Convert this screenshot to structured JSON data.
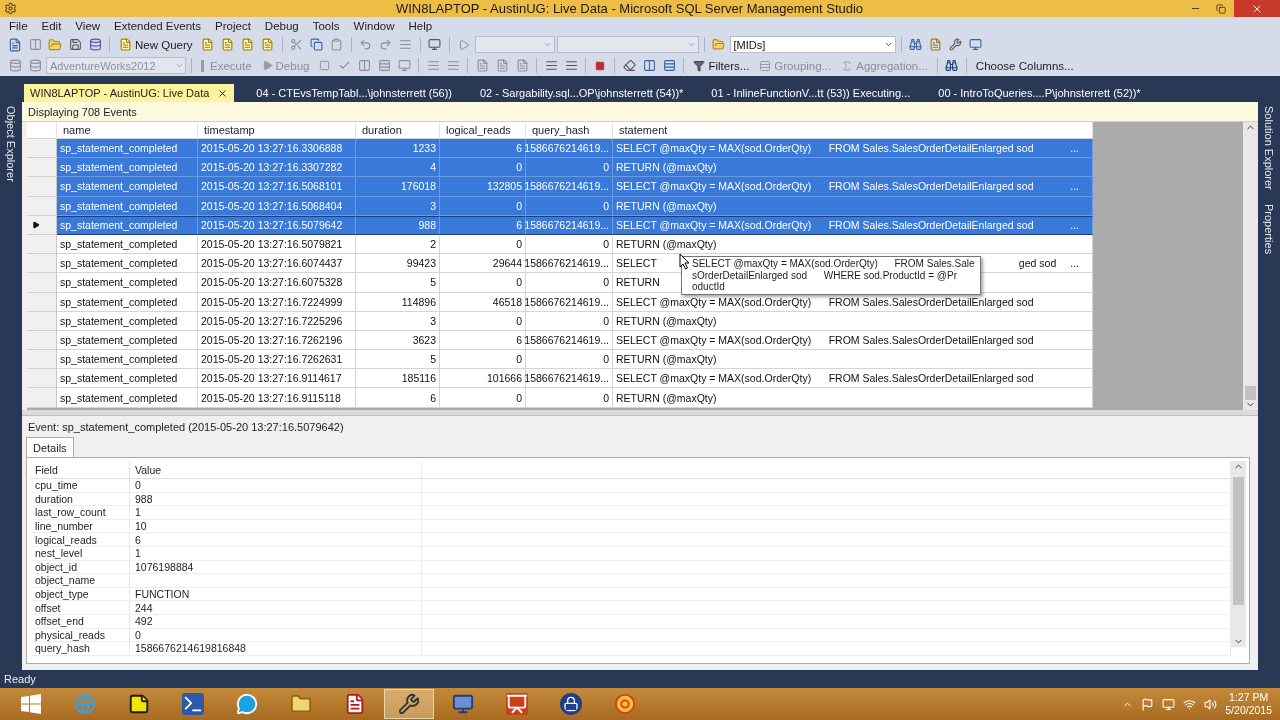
{
  "window": {
    "title": "WIN8LAPTOP - AustinUG: Live Data - Microsoft SQL Server Management Studio"
  },
  "menu": [
    "File",
    "Edit",
    "View",
    "Extended Events",
    "Project",
    "Debug",
    "Tools",
    "Window",
    "Help"
  ],
  "toolbar_1": {
    "new_query": "New Query",
    "combo_1": {
      "disabled": true
    },
    "combo_2": {
      "disabled": true
    },
    "filter_combo": {
      "value": "[MIDs]",
      "disabled": false
    }
  },
  "toolbar_2": {
    "database": {
      "value": "AdventureWorks2012",
      "disabled": true
    },
    "buttons": [
      {
        "kind": "execute",
        "label": "Execute",
        "disabled": true
      },
      {
        "kind": "debug",
        "label": "Debug",
        "disabled": true
      }
    ],
    "event_buttons": [
      {
        "kind": "filter",
        "label": "Filters...",
        "disabled": false
      },
      {
        "kind": "grouping",
        "label": "Grouping...",
        "disabled": true
      },
      {
        "kind": "aggregation",
        "label": "Aggregation...",
        "disabled": true
      },
      {
        "kind": "columns",
        "label": "Choose Columns...",
        "disabled": false
      }
    ]
  },
  "document_tabs": [
    {
      "label": "WIN8LAPTOP - AustinUG: Live Data",
      "selected": true
    },
    {
      "label": "04 - CTEvsTempTabl...\\johnsterrett (56))",
      "selected": false
    },
    {
      "label": "02 - Sargability.sql...OP\\johnsterrett (54))*",
      "selected": false
    },
    {
      "label": "01 - InlineFunctionV...tt (53)) Executing...",
      "selected": false
    },
    {
      "label": "00 - IntroToQueries....P\\johnsterrett (52))*",
      "selected": false
    }
  ],
  "side_panels": {
    "left": [
      "Object Explorer"
    ],
    "right": [
      "Solution Explorer",
      "Properties"
    ]
  },
  "events_view": {
    "status": "Displaying 708 Events",
    "columns": [
      "name",
      "timestamp",
      "duration",
      "logical_reads",
      "query_hash",
      "statement"
    ],
    "rows": [
      {
        "selected": true,
        "current": false,
        "cells": [
          "sp_statement_completed",
          "2015-05-20 13:27:16.3306888",
          "1233",
          "6",
          "1586676214619..."
        ],
        "statement": "SELECT @maxQty = MAX(sod.OrderQty)      FROM Sales.SalesOrderDetailEnlarged sod",
        "more": "..."
      },
      {
        "selected": true,
        "current": false,
        "cells": [
          "sp_statement_completed",
          "2015-05-20 13:27:16.3307282",
          "4",
          "0",
          "0"
        ],
        "statement": "RETURN (@maxQty)"
      },
      {
        "selected": true,
        "current": false,
        "cells": [
          "sp_statement_completed",
          "2015-05-20 13:27:16.5068101",
          "176018",
          "132805",
          "1586676214619..."
        ],
        "statement": "SELECT @maxQty = MAX(sod.OrderQty)      FROM Sales.SalesOrderDetailEnlarged sod",
        "more": "..."
      },
      {
        "selected": true,
        "current": false,
        "cells": [
          "sp_statement_completed",
          "2015-05-20 13:27:16.5068404",
          "3",
          "0",
          "0"
        ],
        "statement": "RETURN (@maxQty)"
      },
      {
        "selected": true,
        "current": true,
        "cells": [
          "sp_statement_completed",
          "2015-05-20 13:27:16.5079642",
          "988",
          "6",
          "1586676214619..."
        ],
        "statement": "SELECT @maxQty = MAX(sod.OrderQty)      FROM Sales.SalesOrderDetailEnlarged sod",
        "more": "..."
      },
      {
        "selected": false,
        "current": false,
        "cells": [
          "sp_statement_completed",
          "2015-05-20 13:27:16.5079821",
          "2",
          "0",
          "0"
        ],
        "statement": "RETURN (@maxQty)"
      },
      {
        "selected": false,
        "current": false,
        "cells": [
          "sp_statement_completed",
          "2015-05-20 13:27:16.6074437",
          "99423",
          "29644",
          "1586676214619..."
        ],
        "statement": "SELECT",
        "statement_tail": "ged sod",
        "more": "..."
      },
      {
        "selected": false,
        "current": false,
        "cells": [
          "sp_statement_completed",
          "2015-05-20 13:27:16.6075328",
          "5",
          "0",
          "0"
        ],
        "statement": "RETURN"
      },
      {
        "selected": false,
        "current": false,
        "cells": [
          "sp_statement_completed",
          "2015-05-20 13:27:16.7224999",
          "114896",
          "46518",
          "1586676214619..."
        ],
        "statement": "SELECT @maxQty = MAX(sod.OrderQty)      FROM Sales.SalesOrderDetailEnlarged sod"
      },
      {
        "selected": false,
        "current": false,
        "cells": [
          "sp_statement_completed",
          "2015-05-20 13:27:16.7225296",
          "3",
          "0",
          "0"
        ],
        "statement": "RETURN (@maxQty)"
      },
      {
        "selected": false,
        "current": false,
        "cells": [
          "sp_statement_completed",
          "2015-05-20 13:27:16.7262196",
          "3623",
          "6",
          "1586676214619..."
        ],
        "statement": "SELECT @maxQty = MAX(sod.OrderQty)      FROM Sales.SalesOrderDetailEnlarged sod"
      },
      {
        "selected": false,
        "current": false,
        "cells": [
          "sp_statement_completed",
          "2015-05-20 13:27:16.7262631",
          "5",
          "0",
          "0"
        ],
        "statement": "RETURN (@maxQty)"
      },
      {
        "selected": false,
        "current": false,
        "cells": [
          "sp_statement_completed",
          "2015-05-20 13:27:16.9114617",
          "185116",
          "101666",
          "1586676214619..."
        ],
        "statement": "SELECT @maxQty = MAX(sod.OrderQty)      FROM Sales.SalesOrderDetailEnlarged sod"
      },
      {
        "selected": false,
        "current": false,
        "cells": [
          "sp_statement_completed",
          "2015-05-20 13:27:16.9115118",
          "6",
          "0",
          "0"
        ],
        "statement": "RETURN (@maxQty)"
      }
    ],
    "tooltip": {
      "lines": [
        "SELECT @maxQty = MAX(sod.OrderQty)      FROM Sales.Sale",
        "sOrderDetailEnlarged sod      WHERE sod.ProductId = @Pr",
        "oductId"
      ]
    }
  },
  "event_details": {
    "title": "Event: sp_statement_completed (2015-05-20 13:27:16.5079642)",
    "tabs": [
      {
        "label": "Details",
        "selected": true
      }
    ],
    "columns": [
      "Field",
      "Value"
    ],
    "rows": [
      {
        "field": "cpu_time",
        "value": "0"
      },
      {
        "field": "duration",
        "value": "988"
      },
      {
        "field": "last_row_count",
        "value": "1"
      },
      {
        "field": "line_number",
        "value": "10"
      },
      {
        "field": "logical_reads",
        "value": "6"
      },
      {
        "field": "nest_level",
        "value": "1"
      },
      {
        "field": "object_id",
        "value": "1076198884"
      },
      {
        "field": "object_name"
      },
      {
        "field": "object_type",
        "value": "FUNCTION"
      },
      {
        "field": "offset",
        "value": "244"
      },
      {
        "field": "offset_end",
        "value": "492"
      },
      {
        "field": "physical_reads",
        "value": "0"
      },
      {
        "field": "query_hash",
        "value": "1586676214619816848"
      }
    ]
  },
  "status_bar": "Ready",
  "taskbar": {
    "apps": [
      {
        "kind": "globe",
        "active": false
      },
      {
        "kind": "note",
        "active": false
      },
      {
        "kind": "terminal",
        "active": false
      },
      {
        "kind": "chat",
        "active": false
      },
      {
        "kind": "folder",
        "active": false
      },
      {
        "kind": "document",
        "active": false
      },
      {
        "kind": "tools",
        "active": true
      },
      {
        "kind": "computer",
        "active": false
      },
      {
        "kind": "slides",
        "active": false
      },
      {
        "kind": "lock",
        "active": false
      },
      {
        "kind": "browser",
        "active": false
      }
    ],
    "clock": {
      "time": "1:27 PM",
      "date": "5/20/2015"
    }
  }
}
